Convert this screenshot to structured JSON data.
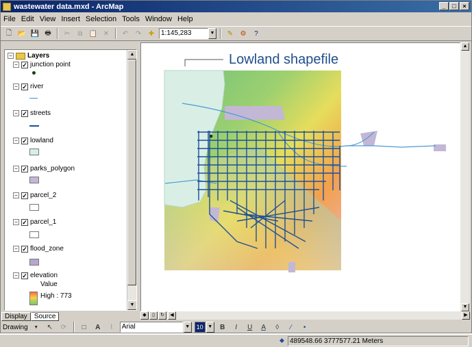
{
  "window": {
    "title": "wastewater data.mxd - ArcMap"
  },
  "menu": [
    "File",
    "Edit",
    "View",
    "Insert",
    "Selection",
    "Tools",
    "Window",
    "Help"
  ],
  "toolbar": {
    "scale": "1:145,283"
  },
  "toc": {
    "root": "Layers",
    "layers": [
      {
        "name": "junction point",
        "symbol": "point"
      },
      {
        "name": "river",
        "symbol": "line-thin"
      },
      {
        "name": "streets",
        "symbol": "line-thick"
      },
      {
        "name": "lowland",
        "symbol": "fill",
        "color": "#d9efe6"
      },
      {
        "name": "parks_polygon",
        "symbol": "fill",
        "color": "#c3b7d6"
      },
      {
        "name": "parcel_2",
        "symbol": "fill",
        "color": "#ffffff"
      },
      {
        "name": "parcel_1",
        "symbol": "fill",
        "color": "#ffffff"
      },
      {
        "name": "flood_zone",
        "symbol": "fill",
        "color": "#b7a6cf"
      },
      {
        "name": "elevation",
        "symbol": "ramp"
      }
    ],
    "elevation_value_label": "Value",
    "elevation_high": "High : 773"
  },
  "tabs": [
    "Display",
    "Source"
  ],
  "callout": "Lowland shapefile",
  "drawing": {
    "menu": "Drawing",
    "font": "Arial",
    "size": "10"
  },
  "status": {
    "coordinates": "489548.66  3777577.21 Meters"
  },
  "colors": {
    "titlebar": "#0a246a",
    "street": "#1d4f95",
    "lowland": "#d9efe6",
    "parks": "#c3b7d6"
  }
}
